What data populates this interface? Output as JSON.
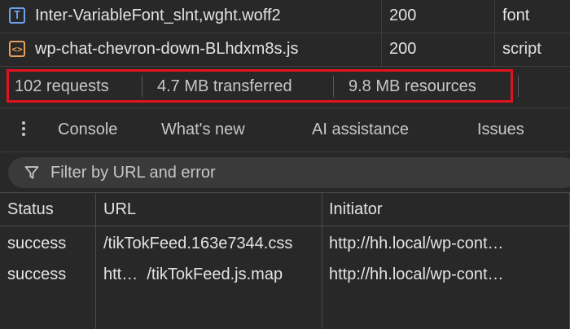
{
  "network": {
    "rows": [
      {
        "icon": "font-file-icon",
        "name": "Inter-VariableFont_slnt,wght.woff2",
        "status": "200",
        "type": "font"
      },
      {
        "icon": "script-file-icon",
        "name": "wp-chat-chevron-down-BLhdxm8s.js",
        "status": "200",
        "type": "script"
      }
    ],
    "summary": {
      "requests": "102 requests",
      "transferred": "4.7 MB transferred",
      "resources": "9.8 MB resources"
    }
  },
  "drawer": {
    "tabs": [
      "Console",
      "What's new",
      "AI assistance",
      "Issues"
    ]
  },
  "filter": {
    "placeholder": "Filter by URL and error"
  },
  "table": {
    "headers": [
      "Status",
      "URL",
      "Initiator"
    ],
    "rows": [
      {
        "status": "success",
        "url": "/tikTokFeed.163e7344.css",
        "initiator": "http://hh.local/wp-cont…"
      },
      {
        "status": "success",
        "url": "htt…  /tikTokFeed.js.map",
        "initiator": "http://hh.local/wp-cont…"
      }
    ]
  },
  "colors": {
    "background": "#282828",
    "highlight": "#e0141e",
    "font_icon": "#6ca0e8",
    "script_icon": "#e8a05a"
  }
}
